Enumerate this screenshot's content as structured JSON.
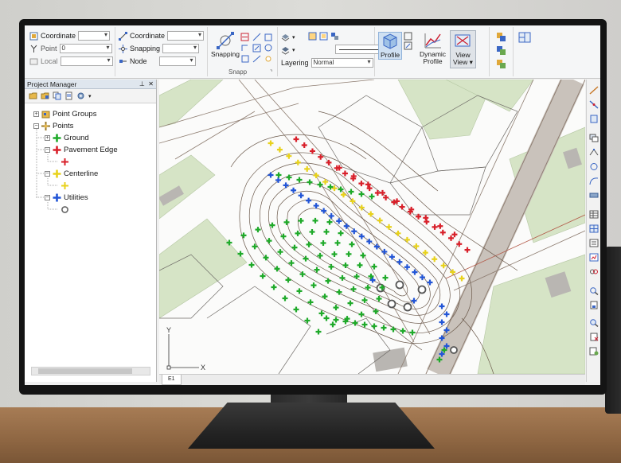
{
  "ribbon": {
    "coord_label": "Coordinate",
    "point_label": "Point",
    "point_value": "0",
    "local_label": "Local",
    "coordinate_label": "Coordinate",
    "snapping_label": "Snapping",
    "node_label": "Node",
    "snapping_btn": "Snapping",
    "snapp_group": "Snapp",
    "layering_label": "Layering",
    "layering_value": "Normal",
    "profile_btn": "Profile",
    "dynamic_profile_line1": "Dynamic",
    "dynamic_profile_line2": "Profile",
    "view_line1": "View",
    "view_line2": "View"
  },
  "project_manager": {
    "title": "Project Manager",
    "pin": "⊥",
    "close": "✕",
    "tree": {
      "point_groups": "Point Groups",
      "points": "Points",
      "ground": "Ground",
      "pavement_edge": "Pavement Edge",
      "centerline": "Centerline",
      "utilities": "Utilities"
    }
  },
  "map": {
    "axis_y": "Y",
    "axis_x": "X"
  },
  "status": {
    "tab": "E1"
  },
  "colors": {
    "ground": "#1faa2a",
    "pavement_edge": "#d8202a",
    "centerline": "#e8d21c",
    "utilities": "#2255d6",
    "contour": "#5a4a3e",
    "parcel": "#cfd9c3",
    "road": "#b8b0a8"
  },
  "icons": [
    "coordinate-icon",
    "point-icon",
    "snapping-icon",
    "node-icon",
    "layer-icon",
    "profile-icon",
    "dynamic-profile-icon",
    "view-icon",
    "circle-manhole-icon"
  ]
}
